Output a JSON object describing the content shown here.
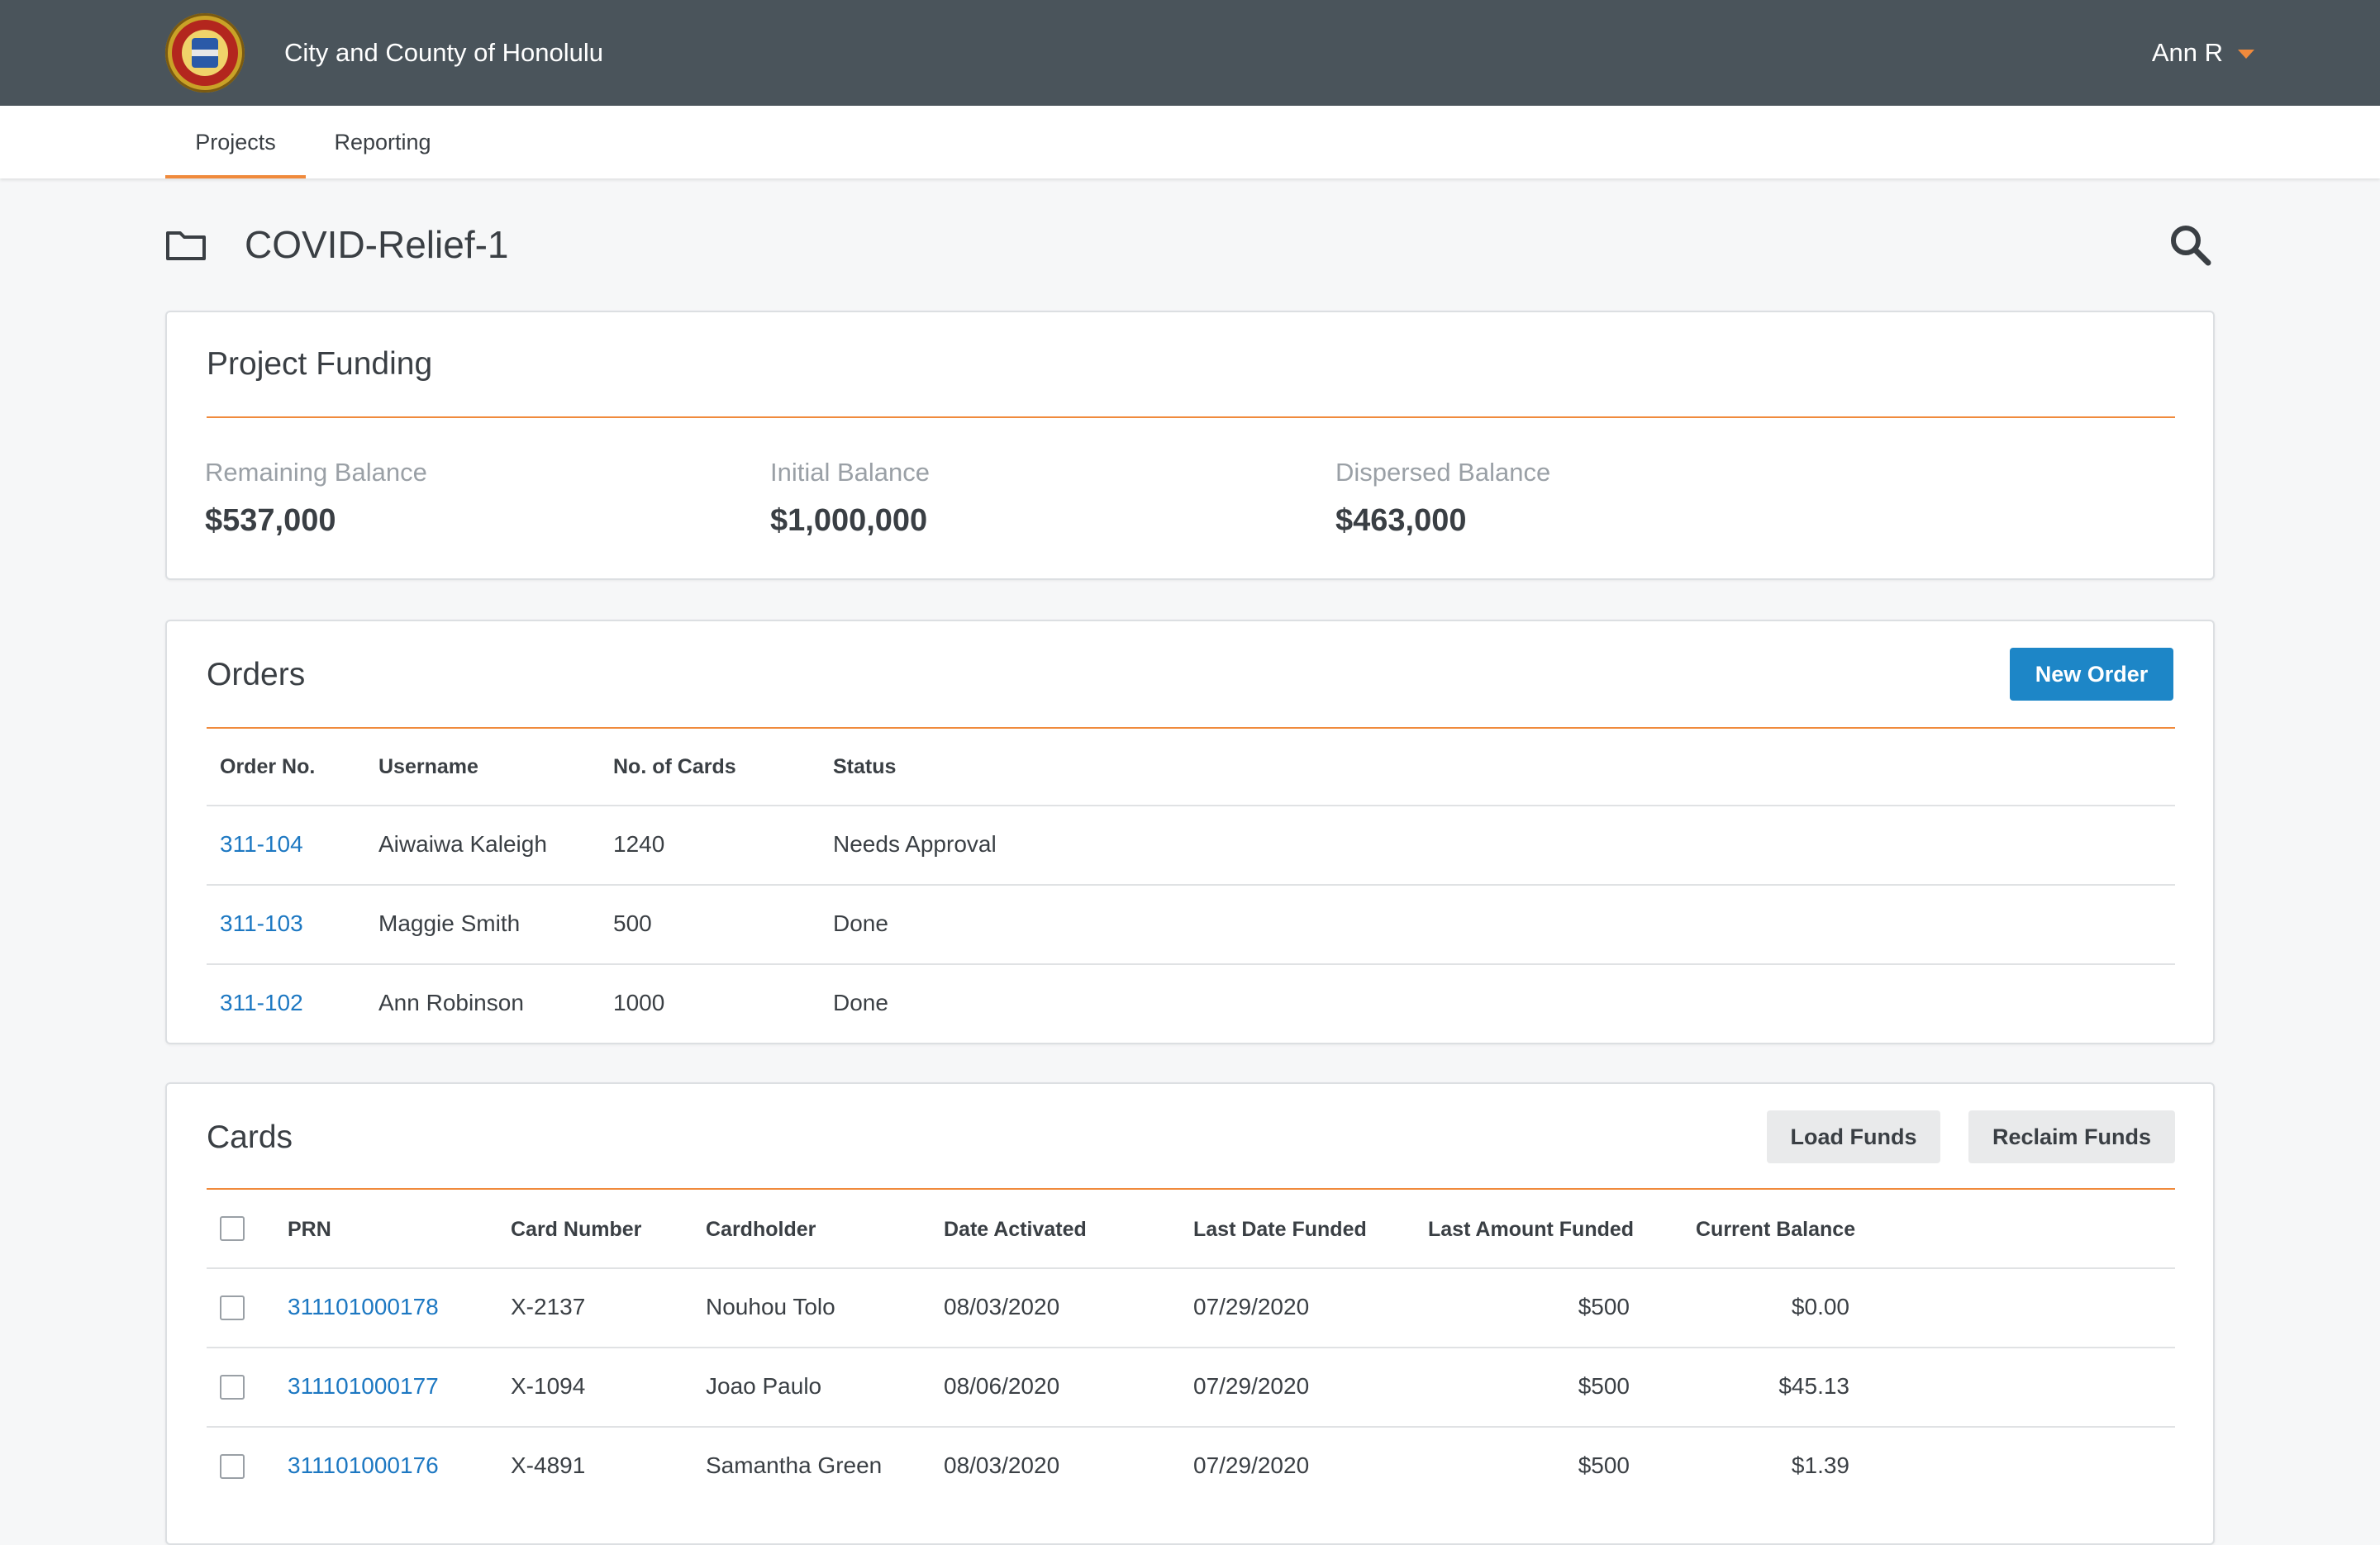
{
  "header": {
    "org_name": "City and County of Honolulu",
    "user_name": "Ann R"
  },
  "nav": {
    "tabs": [
      {
        "label": "Projects",
        "active": true
      },
      {
        "label": "Reporting",
        "active": false
      }
    ]
  },
  "page": {
    "title": "COVID-Relief-1"
  },
  "funding": {
    "title": "Project Funding",
    "metrics": [
      {
        "label": "Remaining Balance",
        "value": "$537,000"
      },
      {
        "label": "Initial Balance",
        "value": "$1,000,000"
      },
      {
        "label": "Dispersed Balance",
        "value": "$463,000"
      }
    ]
  },
  "orders": {
    "title": "Orders",
    "new_order_label": "New Order",
    "columns": [
      "Order No.",
      "Username",
      "No. of Cards",
      "Status"
    ],
    "rows": [
      {
        "order_no": "311-104",
        "username": "Aiwaiwa Kaleigh",
        "cards": "1240",
        "status": "Needs Approval"
      },
      {
        "order_no": "311-103",
        "username": "Maggie Smith",
        "cards": "500",
        "status": "Done"
      },
      {
        "order_no": "311-102",
        "username": "Ann Robinson",
        "cards": "1000",
        "status": "Done"
      }
    ]
  },
  "cards": {
    "title": "Cards",
    "load_funds_label": "Load Funds",
    "reclaim_funds_label": "Reclaim Funds",
    "columns": [
      "PRN",
      "Card Number",
      "Cardholder",
      "Date Activated",
      "Last Date Funded",
      "Last Amount Funded",
      "Current Balance"
    ],
    "rows": [
      {
        "prn": "311101000178",
        "card_number": "X-2137",
        "cardholder": "Nouhou Tolo",
        "date_activated": "08/03/2020",
        "last_date_funded": "07/29/2020",
        "last_amount": "$500",
        "balance": "$0.00"
      },
      {
        "prn": "311101000177",
        "card_number": "X-1094",
        "cardholder": "Joao Paulo",
        "date_activated": "08/06/2020",
        "last_date_funded": "07/29/2020",
        "last_amount": "$500",
        "balance": "$45.13"
      },
      {
        "prn": "311101000176",
        "card_number": "X-4891",
        "cardholder": "Samantha Green",
        "date_activated": "08/03/2020",
        "last_date_funded": "07/29/2020",
        "last_amount": "$500",
        "balance": "$1.39"
      }
    ]
  },
  "colors": {
    "header_bg": "#4a545b",
    "accent": "#f08a3c",
    "primary_button": "#1d86c7",
    "link": "#1d78c2"
  },
  "icons": {
    "seal": "city-seal-icon",
    "user_caret": "caret-down-icon",
    "folder": "folder-icon",
    "search": "search-icon",
    "checkbox": "checkbox-icon"
  }
}
